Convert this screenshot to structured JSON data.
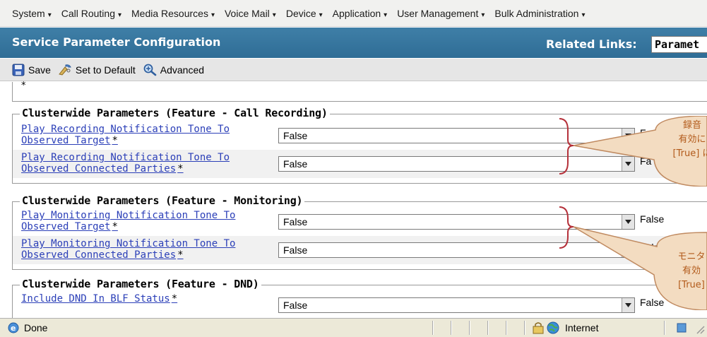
{
  "menu": {
    "items": [
      {
        "label": "System"
      },
      {
        "label": "Call Routing"
      },
      {
        "label": "Media Resources"
      },
      {
        "label": "Voice Mail"
      },
      {
        "label": "Device"
      },
      {
        "label": "Application"
      },
      {
        "label": "User Management"
      },
      {
        "label": "Bulk Administration"
      }
    ],
    "caret": "▾"
  },
  "header": {
    "title": "Service Parameter Configuration",
    "related_links_label": "Related Links:",
    "related_links_value": "Paramet"
  },
  "toolbar": {
    "save_label": "Save",
    "default_label": "Set to Default",
    "advanced_label": "Advanced"
  },
  "top_fragment": "*",
  "sections": [
    {
      "legend": "Clusterwide Parameters (Feature - Call Recording)",
      "rows": [
        {
          "name_line1": "Play Recording Notification Tone To",
          "name_line2": "Observed Target",
          "required": "*",
          "value": "False",
          "default": "F"
        },
        {
          "name_line1": "Play Recording Notification Tone To",
          "name_line2": "Observed Connected Parties",
          "required": "*",
          "value": "False",
          "default": "Fa"
        }
      ]
    },
    {
      "legend": "Clusterwide Parameters (Feature - Monitoring)",
      "rows": [
        {
          "name_line1": "Play Monitoring Notification Tone To",
          "name_line2": "Observed Target",
          "required": "*",
          "value": "False",
          "default": "False"
        },
        {
          "name_line1": "Play Monitoring Notification Tone To",
          "name_line2": "Observed Connected Parties",
          "required": "*",
          "value": "False",
          "default": "False"
        }
      ]
    },
    {
      "legend": "Clusterwide Parameters (Feature - DND)",
      "rows": [
        {
          "name_line1": "Include DND In BLF Status",
          "name_line2": "",
          "required": "*",
          "value": "False",
          "default": "False"
        }
      ]
    }
  ],
  "callouts": [
    {
      "lines": [
        "録音",
        "有効に",
        "[True] に"
      ]
    },
    {
      "lines": [
        "モニタ",
        "有効",
        "[True]"
      ]
    }
  ],
  "statusbar": {
    "status_text": "Done",
    "zone_text": "Internet"
  },
  "colors": {
    "header_bg": "#3674a0",
    "link": "#2b3fb8",
    "callout_fill": "#f3dcc1",
    "callout_border": "#c08a60",
    "bracket": "#b5313a"
  }
}
